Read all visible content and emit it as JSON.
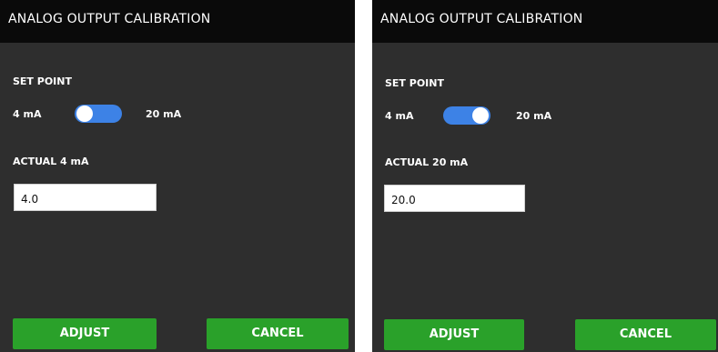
{
  "colors": {
    "button": "#2aa12a",
    "toggle_track": "#3d82e6",
    "panel": "#2e2e2e",
    "titlebar": "#0a0a0a"
  },
  "screens": [
    {
      "title": "ANALOG OUTPUT CALIBRATION",
      "set_point_label": "SET POINT",
      "toggle_left_label": "4 mA",
      "toggle_right_label": "20 mA",
      "toggle_state": "4 mA",
      "actual_label": "ACTUAL 4 mA",
      "actual_value": "4.0",
      "adjust_label": "ADJUST",
      "cancel_label": "CANCEL"
    },
    {
      "title": "ANALOG OUTPUT CALIBRATION",
      "set_point_label": "SET POINT",
      "toggle_left_label": "4 mA",
      "toggle_right_label": "20 mA",
      "toggle_state": "20 mA",
      "actual_label": "ACTUAL 20 mA",
      "actual_value": "20.0",
      "adjust_label": "ADJUST",
      "cancel_label": "CANCEL"
    }
  ]
}
